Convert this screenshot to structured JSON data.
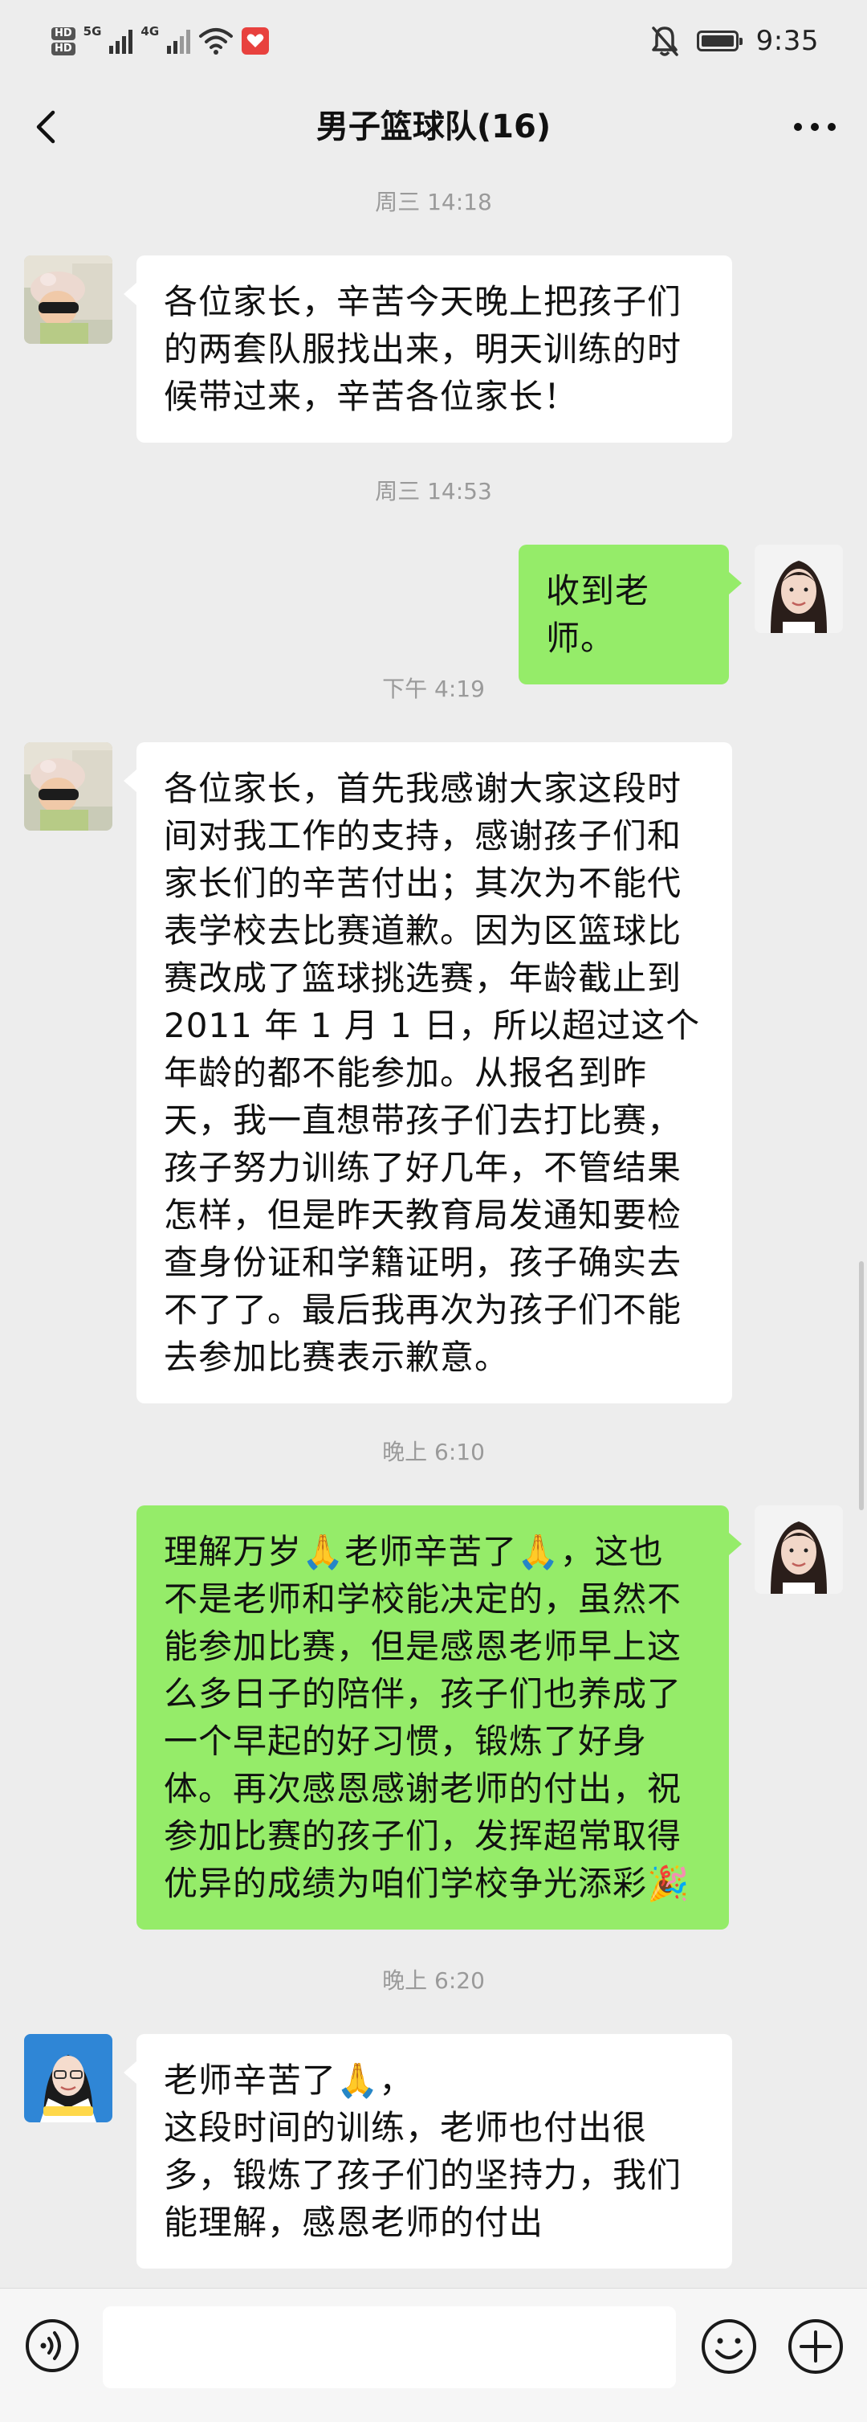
{
  "status_bar": {
    "hd_tag": "HD",
    "network_1": "5G",
    "network_2": "4G",
    "time": "9:35",
    "icons": [
      "hd-icon",
      "signal-5g-icon",
      "signal-4g-icon",
      "wifi-icon",
      "app-notification-icon",
      "mute-bell-icon",
      "battery-icon"
    ]
  },
  "nav": {
    "title": "男子篮球队(16)",
    "back_icon": "chevron-left-icon",
    "more_icon": "more-dots-icon"
  },
  "messages": [
    {
      "kind": "time",
      "text": "周三 14:18"
    },
    {
      "kind": "msg",
      "side": "left",
      "avatar": "child-avatar",
      "text": "各位家长，辛苦今天晚上把孩子们\n的两套队服找出来，明天训练的时\n候带过来，辛苦各位家长！"
    },
    {
      "kind": "time",
      "text": "周三 14:53"
    },
    {
      "kind": "msg",
      "side": "right",
      "avatar": "woman-avatar",
      "text": "收到老师。"
    },
    {
      "kind": "time",
      "text": "下午 4:19"
    },
    {
      "kind": "msg",
      "side": "left",
      "avatar": "child-avatar",
      "text": "各位家长，首先我感谢大家这段时\n间对我工作的支持，感谢孩子们和\n家长们的辛苦付出；其次为不能代\n表学校去比赛道歉。因为区篮球比\n赛改成了篮球挑选赛，年龄截止到\n2011 年 1 月 1 日，所以超过这个\n年龄的都不能参加。从报名到昨\n天，我一直想带孩子们去打比赛，\n孩子努力训练了好几年，不管结果\n怎样，但是昨天教育局发通知要检\n查身份证和学籍证明，孩子确实去\n不了了。最后我再次为孩子们不能\n去参加比赛表示歉意。"
    },
    {
      "kind": "time",
      "text": "晚上 6:10"
    },
    {
      "kind": "msg",
      "side": "right",
      "avatar": "woman-avatar",
      "text": "理解万岁🙏老师辛苦了🙏，这也\n不是老师和学校能决定的，虽然不\n能参加比赛，但是感恩老师早上这\n么多日子的陪伴，孩子们也养成了\n一个早起的好习惯，锻炼了好身\n体。再次感恩感谢老师的付出，祝\n参加比赛的孩子们，发挥超常取得\n优异的成绩为咱们学校争光添彩🎉"
    },
    {
      "kind": "time",
      "text": "晚上 6:20"
    },
    {
      "kind": "msg",
      "side": "left",
      "avatar": "woman-doctor-avatar",
      "text": "老师辛苦了🙏，\n这段时间的训练，老师也付出很\n多，锻炼了孩子们的坚持力，我们\n能理解，感恩老师的付出"
    }
  ],
  "input_bar": {
    "value": "",
    "placeholder": "",
    "voice_icon": "voice-icon",
    "emoji_icon": "emoji-icon",
    "plus_icon": "plus-icon"
  },
  "colors": {
    "background": "#ededed",
    "bubble_in": "#ffffff",
    "bubble_out": "#95ec69",
    "time_label": "#9a9a9a"
  }
}
